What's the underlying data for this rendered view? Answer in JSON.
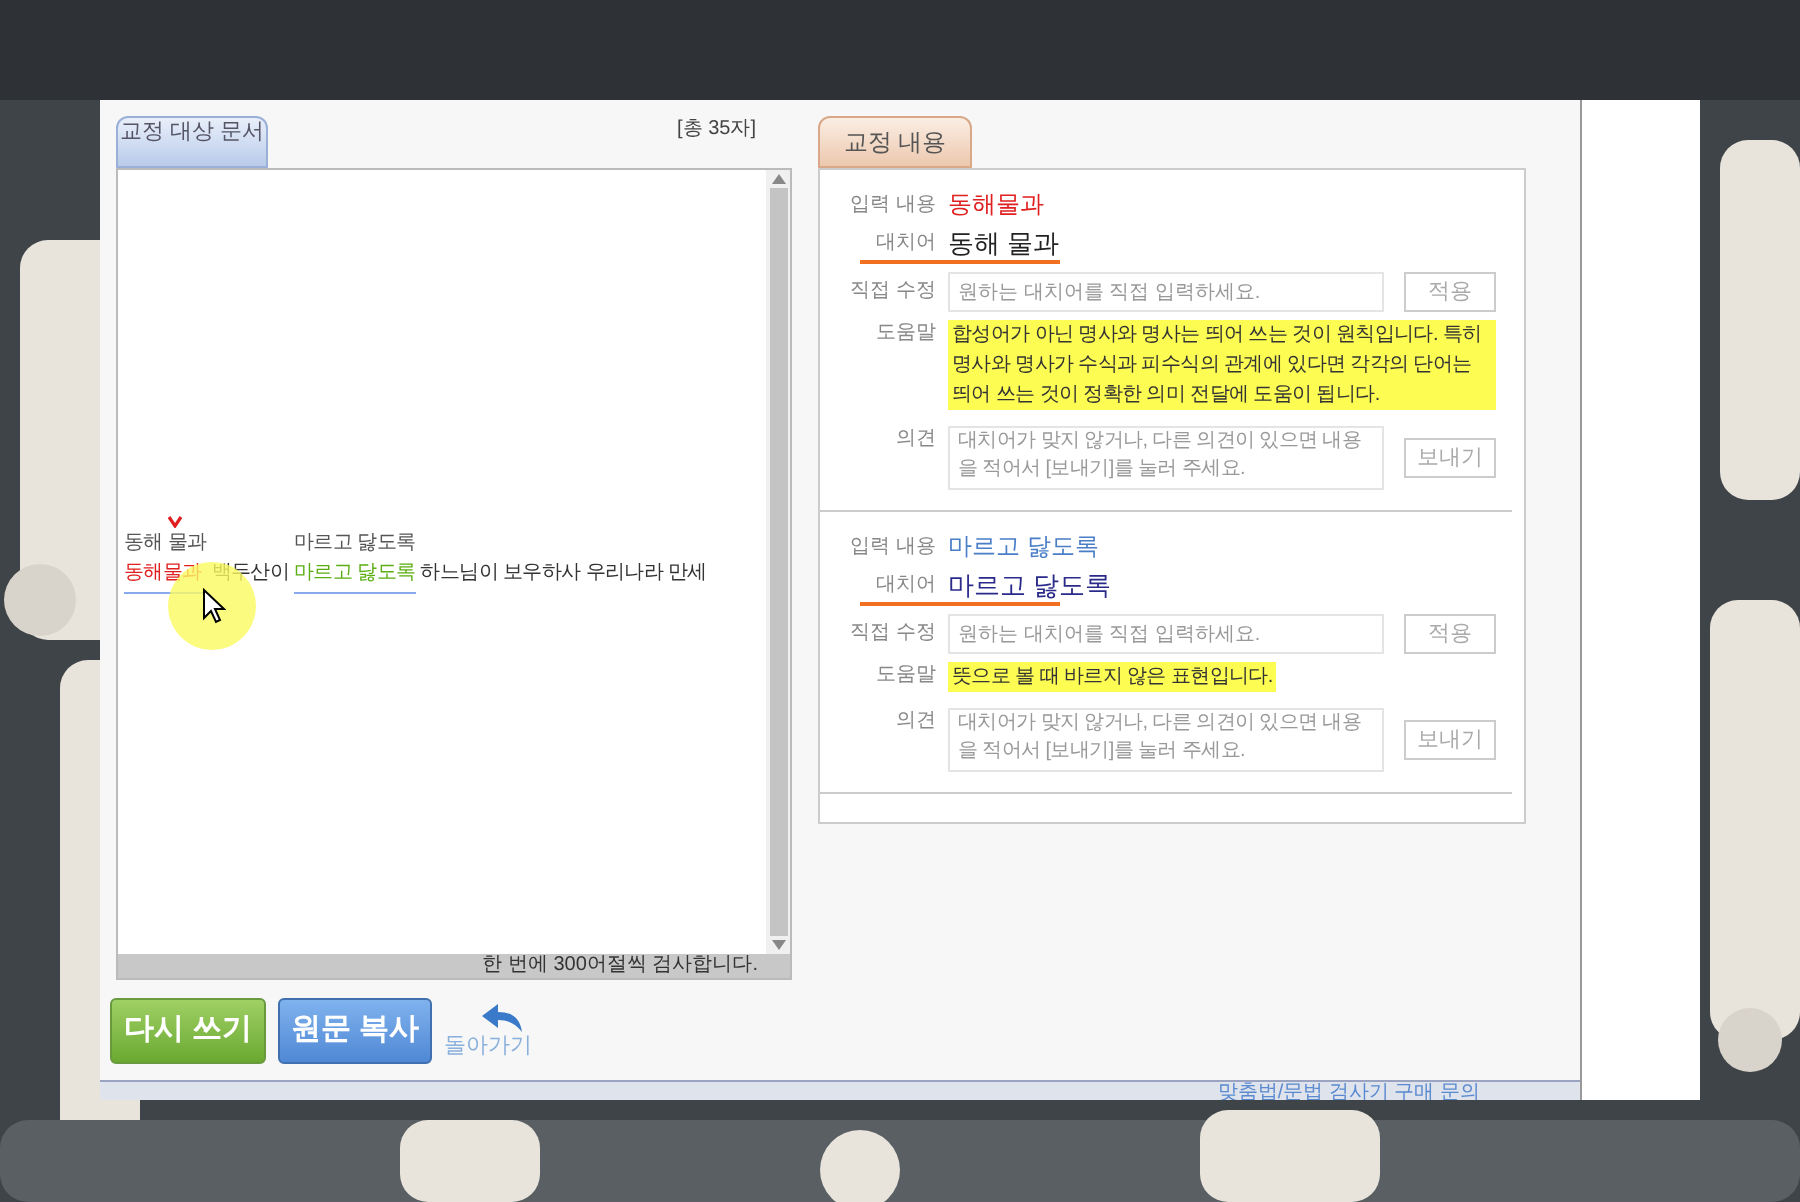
{
  "document": {
    "tab": "교정 대상 문서",
    "count": "[총 35자]",
    "segments": [
      {
        "kind": "error",
        "text": "동해물과",
        "suggestion": "동해 물과",
        "color": "#e02020",
        "caret": true
      },
      {
        "kind": "plain",
        "text": " 백두산이 "
      },
      {
        "kind": "error",
        "text": "마르고 닳도록",
        "suggestion": "마르고 닳도록",
        "color": "#5cae14",
        "caret": false
      },
      {
        "kind": "plain",
        "text": " 하느님이 보우하사 우리나라 만세"
      }
    ],
    "status": "한 번에 300어절씩 검사합니다."
  },
  "buttons": {
    "rewrite": "다시 쓰기",
    "copy": "원문 복사",
    "back": "돌아가기"
  },
  "corrections": {
    "tab": "교정 내용",
    "items": [
      {
        "input_label": "입력 내용",
        "input": {
          "text": "동해물과",
          "color": "#e02020"
        },
        "replacement_label": "대치어",
        "replacement": {
          "text": "동해 물과",
          "color": "#222222"
        },
        "edit_label": "직접 수정",
        "edit_placeholder": "원하는 대치어를 직접 입력하세요.",
        "apply": "적용",
        "help_label": "도움말",
        "help": "합성어가 아닌 명사와 명사는 띄어 쓰는 것이 원칙입니다. 특히 명사와 명사가 수식과 피수식의 관계에 있다면 각각의 단어는 띄어 쓰는 것이 정확한 의미 전달에 도움이 됩니다.",
        "opinion_label": "의견",
        "opinion_placeholder": "대치어가 맞지 않거나, 다른 의견이 있으면 내용을 적어서 [보내기]를 눌러 주세요.",
        "send": "보내기"
      },
      {
        "input_label": "입력 내용",
        "input": {
          "text": "마르고 닳도록",
          "color": "#4a7fc8"
        },
        "replacement_label": "대치어",
        "replacement": {
          "text": "마르고 닳도록",
          "color": "#2a2a8a"
        },
        "edit_label": "직접 수정",
        "edit_placeholder": "원하는 대치어를 직접 입력하세요.",
        "apply": "적용",
        "help_label": "도움말",
        "help": "뜻으로 볼 때 바르지 않은 표현입니다.",
        "opinion_label": "의견",
        "opinion_placeholder": "대치어가 맞지 않거나, 다른 의견이 있으면 내용을 적어서 [보내기]를 눌러 주세요.",
        "send": "보내기"
      }
    ]
  },
  "footer_link": "맞춤법/문법 검사기 구매 문의"
}
